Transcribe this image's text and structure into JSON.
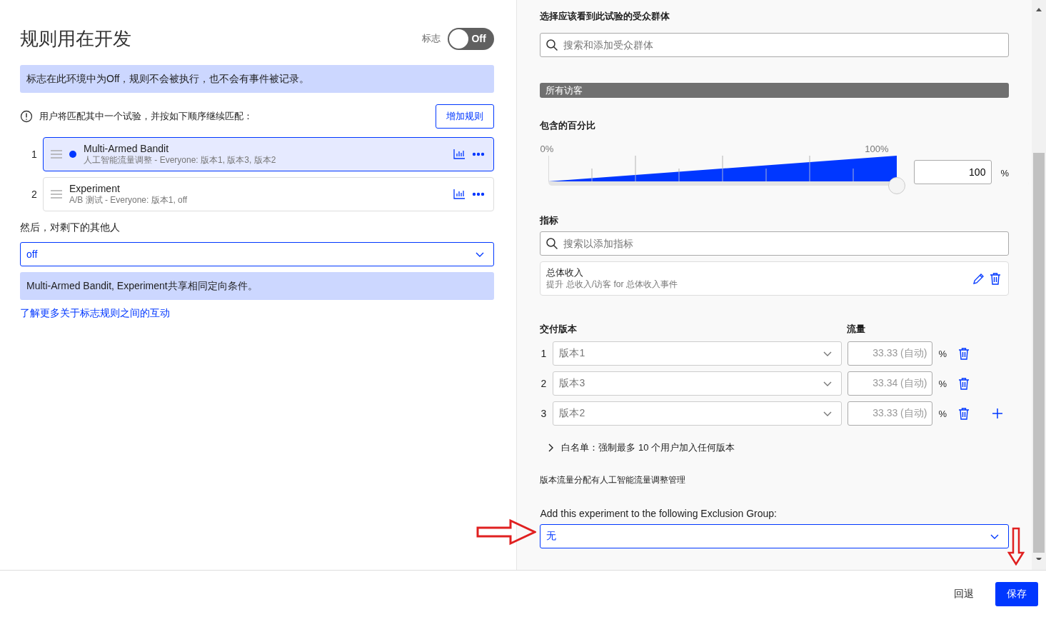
{
  "left": {
    "title": "规则用在开发",
    "flag_label": "标志",
    "flag_toggle": {
      "label": "Off",
      "on": false
    },
    "notice": "标志在此环境中为Off，规则不会被执行，也不会有事件被记录。",
    "match_info": "用户将匹配其中一个试验，并按如下顺序继续匹配：",
    "add_rule_button": "增加规则",
    "rules": [
      {
        "number": "1",
        "name": "Multi-Armed Bandit",
        "detail": "人工智能流量调整 - Everyone: 版本1, 版本3, 版本2",
        "selected": true,
        "dot": true
      },
      {
        "number": "2",
        "name": "Experiment",
        "detail": "A/B 测试 - Everyone: 版本1, off",
        "selected": false,
        "dot": false
      }
    ],
    "fallback_label": "然后，对剩下的其他人",
    "fallback_select": "off",
    "shared_notice": "Multi-Armed Bandit, Experiment共享相同定向条件。",
    "learn_more_link": "了解更多关于标志规则之间的互动"
  },
  "right": {
    "audience_hint": "选择应该看到此试验的受众群体",
    "audience_search": {
      "placeholder": "搜索和添加受众群体"
    },
    "audience_tag": "所有访客",
    "percentage": {
      "label": "包含的百分比",
      "min_label": "0%",
      "max_label": "100%",
      "level": 1,
      "value": "100",
      "unit": "%"
    },
    "metrics": {
      "label": "指标",
      "search": {
        "placeholder": "搜索以添加指标"
      },
      "items": [
        {
          "name": "总体收入",
          "detail": "提升 总收入/访客 for 总体收入事件"
        }
      ]
    },
    "variations": {
      "label": "交付版本",
      "traffic_label": "流量",
      "rows": [
        {
          "number": "1",
          "variation": "版本1",
          "traffic": "33.33 (自动)",
          "unit": "%"
        },
        {
          "number": "2",
          "variation": "版本3",
          "traffic": "33.34 (自动)",
          "unit": "%"
        },
        {
          "number": "3",
          "variation": "版本2",
          "traffic": "33.33 (自动)",
          "unit": "%"
        }
      ]
    },
    "whitelist": {
      "label": "白名单：强制最多 10 个用户加入任何版本",
      "expanded": false
    },
    "managed_note": "版本流量分配有人工智能流量调整管理",
    "exclusion": {
      "label": "Add this experiment to the following Exclusion Group:",
      "value": "无"
    }
  },
  "footer": {
    "buttons": [
      {
        "label": "回退",
        "kind": "link"
      },
      {
        "label": "保存",
        "kind": "primary"
      }
    ]
  }
}
